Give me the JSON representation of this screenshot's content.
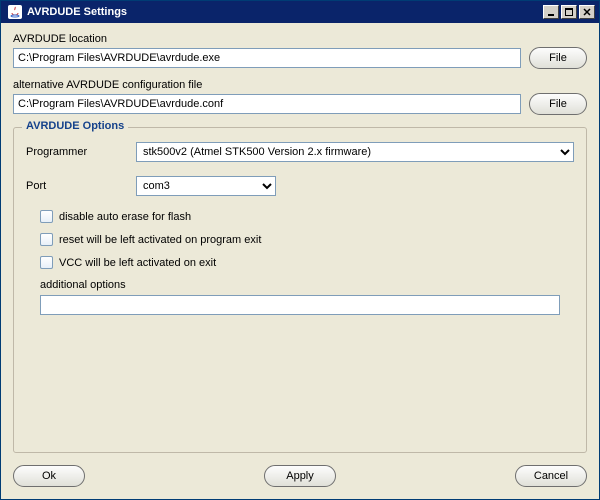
{
  "window": {
    "title": "AVRDUDE Settings"
  },
  "location": {
    "label": "AVRDUDE location",
    "value": "C:\\Program Files\\AVRDUDE\\avrdude.exe",
    "file_button": "File"
  },
  "config": {
    "label": "alternative AVRDUDE configuration file",
    "value": "C:\\Program Files\\AVRDUDE\\avrdude.conf",
    "file_button": "File"
  },
  "options": {
    "group_title": "AVRDUDE Options",
    "programmer_label": "Programmer",
    "programmer_value": "stk500v2 (Atmel STK500 Version 2.x firmware)",
    "port_label": "Port",
    "port_value": "com3",
    "checks": {
      "disable_erase": "disable auto erase for flash",
      "reset_left": "reset will be left activated on program exit",
      "vcc_left": "VCC will be left activated on exit"
    },
    "additional_label": "additional options",
    "additional_value": ""
  },
  "buttons": {
    "ok": "Ok",
    "apply": "Apply",
    "cancel": "Cancel"
  }
}
